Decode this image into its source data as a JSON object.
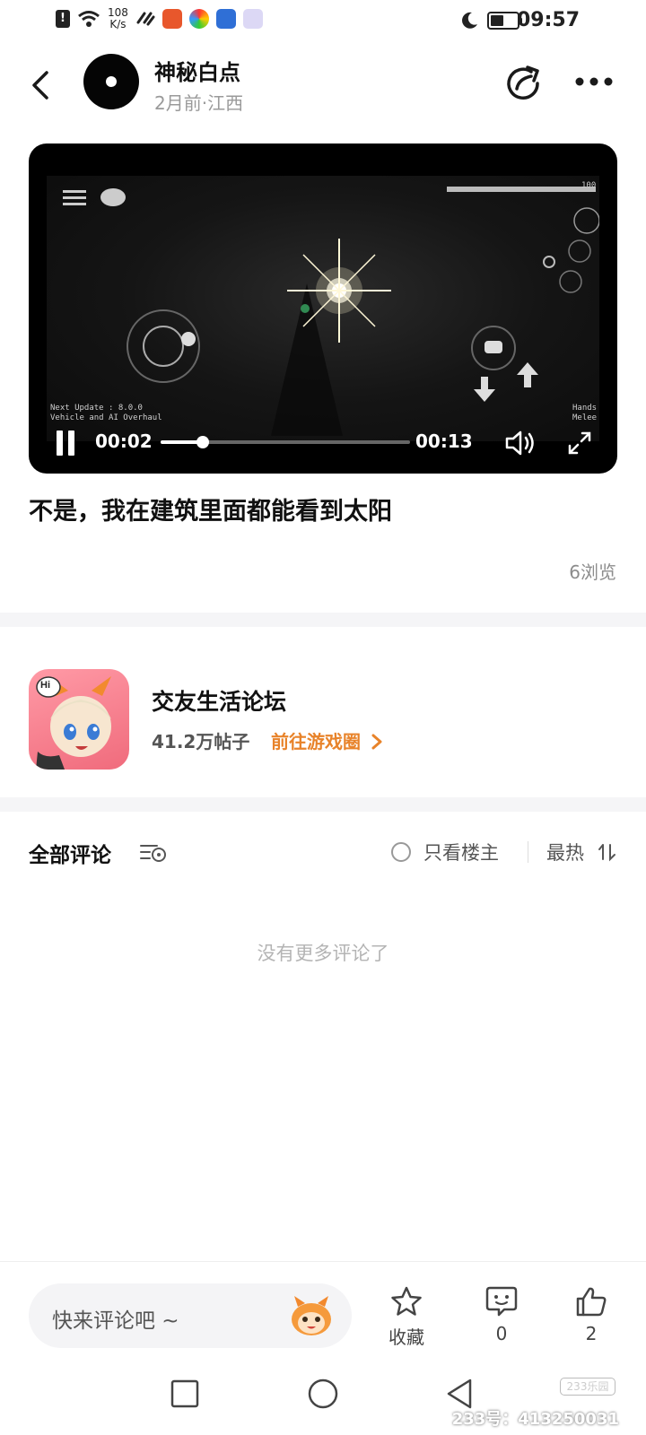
{
  "status_bar": {
    "network_speed": "108\nK/s",
    "network_speed_top": "108",
    "network_speed_bottom": "K/s",
    "time": "09:57",
    "battery_level": 0.55
  },
  "post": {
    "author": "神秘白点",
    "meta": "2月前·江西",
    "title": "不是，我在建筑里面都能看到太阳",
    "views": "6浏览"
  },
  "video": {
    "current_time": "00:02",
    "duration": "00:13",
    "progress": 0.17,
    "overlay_text_left": "Next Update : 8.0.0\nVehicle and AI Overhaul",
    "overlay_line1": "Next Update : 8.0.0",
    "overlay_line2": "Vehicle and AI Overhaul",
    "overlay_hands": "Hands",
    "overlay_melee": "Melee",
    "overlay_health": "100"
  },
  "forum": {
    "name": "交友生活论坛",
    "posts": "41.2万帖子",
    "link": "前往游戏圈",
    "icon_badge": "Hi"
  },
  "comments": {
    "title": "全部评论",
    "owner_only": "只看楼主",
    "sort": "最热",
    "empty": "没有更多评论了"
  },
  "bottom_bar": {
    "placeholder": "快来评论吧 ~",
    "favorite_label": "收藏",
    "comment_count": "0",
    "like_count": "2"
  },
  "watermark": {
    "logo": "233乐园",
    "id_text": "233号：413250031"
  },
  "colors": {
    "accent_orange": "#e8832a",
    "muted_gray": "#9a9a9a",
    "divider": "#f5f5f7"
  }
}
